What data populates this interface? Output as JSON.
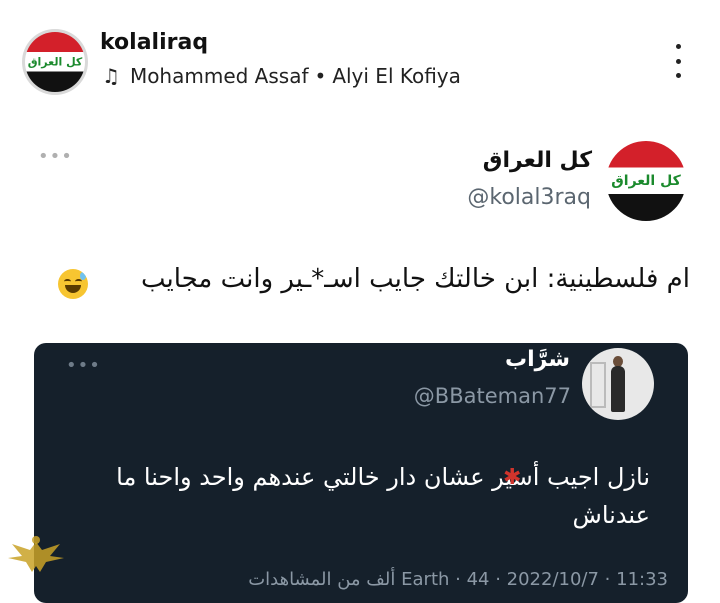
{
  "post": {
    "username": "kolaliraq",
    "avatar_text": "كل العراق",
    "music": {
      "icon": "music-note-icon",
      "artist": "Mohammed Assaf",
      "separator": "•",
      "song": "Alyi El Kofiya"
    }
  },
  "tweet": {
    "name": "كل العراق",
    "handle": "@kolal3raq",
    "avatar_text": "كل العراق",
    "text": "ام فلسطينية: ابن خالتك جايب اسـ*ـير وانت مجايب",
    "emoji": "sweat-smile-emoji"
  },
  "quoted": {
    "name": "شرَّاب",
    "handle": "@BBateman77",
    "text": "نازل اجيب أسير عشان دار خالتي عندهم واحد واحنا ما عندناش",
    "footer": "11:33 · 2022/10/7 · Earth · 44 ألف من المشاهدات"
  },
  "colors": {
    "dark_card": "#15202b",
    "flag_red": "#d3202a",
    "flag_green_text": "#1b8a2d",
    "handle_gray": "#5b6670"
  }
}
